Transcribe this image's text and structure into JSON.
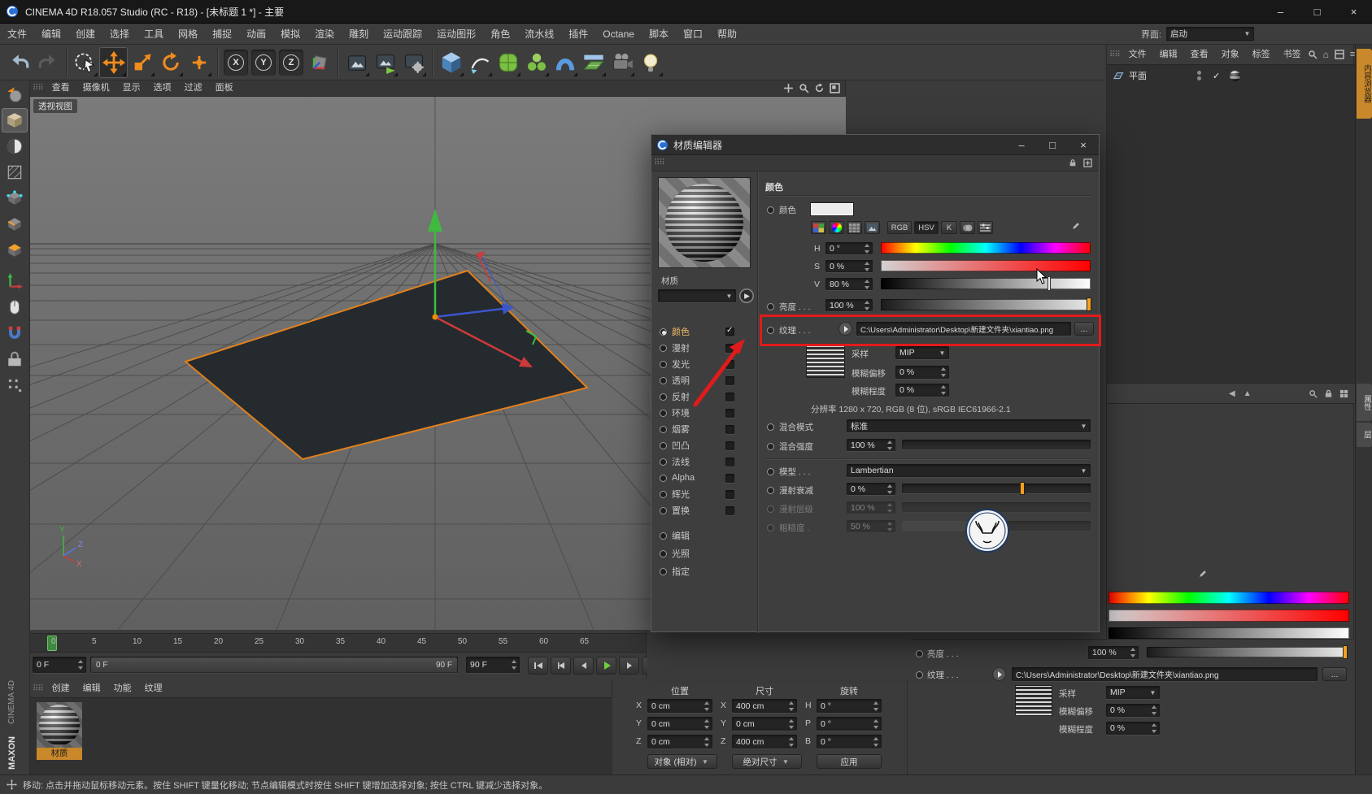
{
  "window": {
    "title": "CINEMA 4D R18.057 Studio (RC - R18) - [未标题 1 *] - 主要"
  },
  "menubar": {
    "items": [
      "文件",
      "编辑",
      "创建",
      "选择",
      "工具",
      "网格",
      "捕捉",
      "动画",
      "模拟",
      "渲染",
      "雕刻",
      "运动跟踪",
      "运动图形",
      "角色",
      "流水线",
      "插件",
      "Octane",
      "脚本",
      "窗口",
      "帮助"
    ],
    "interface_label": "界面:",
    "interface_value": "启动"
  },
  "toolbar": {
    "axis_lock": [
      "X",
      "Y",
      "Z"
    ]
  },
  "viewport": {
    "menu": [
      "查看",
      "摄像机",
      "显示",
      "选项",
      "过滤",
      "面板"
    ],
    "view_label": "透视视图",
    "axis": {
      "x": "X",
      "y": "Y",
      "z": "Z"
    }
  },
  "timeline": {
    "ticks": [
      "0",
      "5",
      "10",
      "15",
      "20",
      "25",
      "30",
      "35",
      "40",
      "45",
      "50",
      "55",
      "60",
      "65"
    ],
    "frame_field": "0 F",
    "end_field": "90 F",
    "range_start": "0 F",
    "range_end": "90 F"
  },
  "material_manager": {
    "menu": [
      "创建",
      "编辑",
      "功能",
      "纹理"
    ],
    "material_name": "材质"
  },
  "coordinates": {
    "headers": [
      "位置",
      "尺寸",
      "旋转"
    ],
    "rows": [
      {
        "pos_label": "X",
        "pos": "0 cm",
        "size_label": "X",
        "size": "400 cm",
        "rot_label": "H",
        "rot": "0 °"
      },
      {
        "pos_label": "Y",
        "pos": "0 cm",
        "size_label": "Y",
        "size": "0 cm",
        "rot_label": "P",
        "rot": "0 °"
      },
      {
        "pos_label": "Z",
        "pos": "0 cm",
        "size_label": "Z",
        "size": "400 cm",
        "rot_label": "B",
        "rot": "0 °"
      }
    ],
    "buttons": [
      "对象 (相对)",
      "绝对尺寸",
      "应用"
    ]
  },
  "object_manager": {
    "menu": [
      "文件",
      "编辑",
      "查看",
      "对象",
      "标签",
      "书签"
    ],
    "object": "平面"
  },
  "right_tabs": [
    {
      "label": "内容浏览器",
      "active": true
    },
    {
      "label": "属性",
      "active": false
    },
    {
      "label": "层",
      "active": false
    }
  ],
  "attribute_panel": {
    "brightness_label": "亮度 . . .",
    "brightness": "100 %",
    "texture_label": "纹理 . . .",
    "texture_path": "C:\\Users\\Administrator\\Desktop\\新建文件夹\\xiantiao.png",
    "browse": "...",
    "sampling_label": "采样",
    "sampling": "MIP",
    "blur_offset_label": "模糊偏移",
    "blur_offset": "0 %",
    "blur_scale_label": "模糊程度",
    "blur_scale": "0 %"
  },
  "material_editor": {
    "title": "材质编辑器",
    "preview_label": "材质",
    "name_field": "",
    "channels": [
      {
        "label": "颜色",
        "checked": true,
        "selected": true
      },
      {
        "label": "漫射",
        "checked": false,
        "selected": false
      },
      {
        "label": "发光",
        "checked": false,
        "selected": false
      },
      {
        "label": "透明",
        "checked": false,
        "selected": false
      },
      {
        "label": "反射",
        "checked": false,
        "selected": false
      },
      {
        "label": "环境",
        "checked": false,
        "selected": false
      },
      {
        "label": "烟雾",
        "checked": false,
        "selected": false
      },
      {
        "label": "凹凸",
        "checked": false,
        "selected": false
      },
      {
        "label": "法线",
        "checked": false,
        "selected": false
      },
      {
        "label": "Alpha",
        "checked": false,
        "selected": false
      },
      {
        "label": "辉光",
        "checked": false,
        "selected": false
      },
      {
        "label": "置换",
        "checked": false,
        "selected": false
      }
    ],
    "extra_items": [
      "编辑",
      "光照",
      "指定"
    ],
    "color": {
      "header": "颜色",
      "swatch_label": "颜色",
      "tools": [
        "RGB",
        "HSV",
        "K"
      ],
      "h_label": "H",
      "h": "0 °",
      "s_label": "S",
      "s": "0 %",
      "v_label": "V",
      "v": "80 %",
      "brightness_label": "亮度 . . .",
      "brightness": "100 %",
      "texture_label": "纹理 . . .",
      "texture_path": "C:\\Users\\Administrator\\Desktop\\新建文件夹\\xiantiao.png",
      "browse": "...",
      "sampling_label": "采样",
      "sampling": "MIP",
      "blur_offset_label": "模糊偏移",
      "blur_offset": "0 %",
      "blur_scale_label": "模糊程度",
      "blur_scale": "0 %",
      "resolution": "分辨率 1280 x 720, RGB (8 位), sRGB IEC61966-2.1",
      "mix_mode_label": "混合模式",
      "mix_mode": "标准",
      "mix_strength_label": "混合强度",
      "mix_strength": "100 %",
      "model_label": "模型 . . .",
      "model": "Lambertian",
      "falloff_label": "漫射衰减",
      "falloff": "0 %",
      "level_label": "漫射层级",
      "level": "100 %",
      "roughness_label": "粗糙度 .",
      "roughness": "50 %"
    }
  },
  "status_bar": "移动: 点击并拖动鼠标移动元素。按住 SHIFT 键量化移动; 节点编辑模式时按住 SHIFT 键增加选择对象; 按住 CTRL 键减少选择对象。",
  "branding": {
    "maxon": "MAXON",
    "c4d": "CINEMA 4D"
  }
}
